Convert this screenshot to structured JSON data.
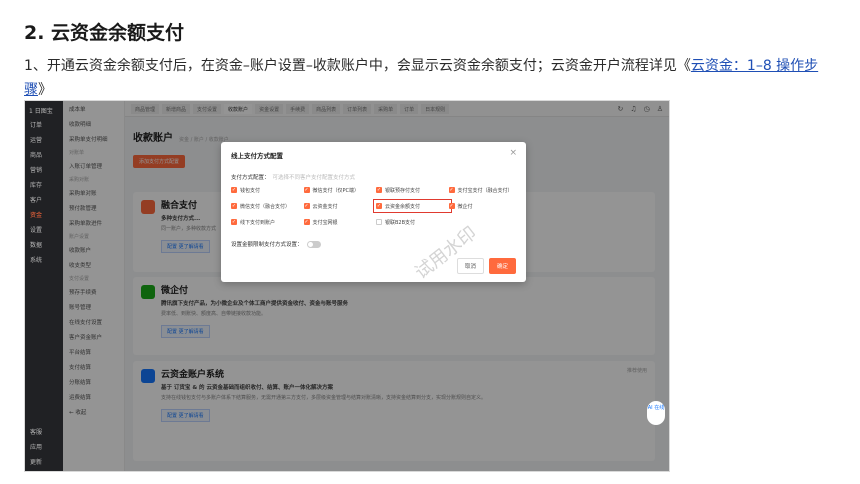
{
  "doc": {
    "title": "2. 云资金余额支付",
    "para_main": "1、开通云资金余额支付后，在资金–账户设置–收款账户中，会显示云资金余额支付；云资金开户流程详见《",
    "para_link": "云资金：1–8 操作步骤",
    "para_tail": "》"
  },
  "app": {
    "logo": "1 日图宝",
    "sidebar": [
      "订单",
      "运营",
      "商品",
      "营销",
      "库存",
      "客户",
      "资金",
      "设置",
      "数据",
      "系统"
    ],
    "sidebar_active_index": 6,
    "sidebar_footer": [
      "客服",
      "应用",
      "更新"
    ],
    "subnav": [
      {
        "type": "item",
        "label": "成本单"
      },
      {
        "type": "item",
        "label": "收款明细"
      },
      {
        "type": "item",
        "label": "采购单支付明细"
      },
      {
        "type": "group",
        "label": "对账单"
      },
      {
        "type": "item",
        "label": "入账订单管理"
      },
      {
        "type": "group",
        "label": "采购对账"
      },
      {
        "type": "item",
        "label": "采购单对账"
      },
      {
        "type": "item",
        "label": "预付款管理"
      },
      {
        "type": "item",
        "label": "采购单款进件"
      },
      {
        "type": "group",
        "label": "账户设置"
      },
      {
        "type": "item",
        "label": "收款账户"
      },
      {
        "type": "item",
        "label": "收支类型"
      },
      {
        "type": "group",
        "label": "支付设置"
      },
      {
        "type": "item",
        "label": "预存手续费"
      },
      {
        "type": "item",
        "label": "账号管理"
      },
      {
        "type": "item",
        "label": "在线支付设置"
      },
      {
        "type": "item",
        "label": "客户资金账户"
      },
      {
        "type": "item",
        "label": "平台结算"
      },
      {
        "type": "item",
        "label": "支付结算"
      },
      {
        "type": "item",
        "label": "分账结算"
      },
      {
        "type": "item",
        "label": "运费结算"
      },
      {
        "type": "item",
        "label": "← 收起"
      }
    ],
    "tabs": [
      "商品管理",
      "新增商品",
      "支付设置",
      "收款账户",
      "资金设置",
      "手续费",
      "商品列表",
      "订单列表",
      "采购单",
      "订单",
      "日本规则"
    ],
    "tabs_active_index": 3,
    "page_title": "收款账户",
    "breadcrumb": "资金 / 账户 / 收款账户",
    "add_button": "添加支付方式配置",
    "cards": [
      {
        "title": "融合支付",
        "desc": "多种支付方式...",
        "text": "同一账户，多种收款方式",
        "button": "配置 更了解请看"
      },
      {
        "title": "微企付",
        "logo_label": "微企付",
        "desc": "腾讯旗下支付产品，为小微企业及个体工商户提供资金收付、资金与账号服务",
        "text": "费率低、到账快、额度高、自带链接收款功能。",
        "button": "配置 更了解请看"
      },
      {
        "title": "云资金账户系统",
        "desc": "基于 订货宝 & 的 云资金基础而组织收付、结算、账户一体化解决方案",
        "text": "支持在线钱包支付与多账户体系下结算服务，无需开通第三方支付，多层级资金管理与结算对账清晰，支持资金结算到分支，实现分账规则自定义。",
        "button": "配置 更了解请看",
        "tag": "推荐使用"
      }
    ],
    "float_help": "AI 在线"
  },
  "modal": {
    "title": "线上支付方式配置",
    "close": "×",
    "label": "支付方式配置：",
    "hint": "可选择不同客户支付配置支付方式",
    "options": [
      {
        "label": "钱包支付",
        "checked": true
      },
      {
        "label": "微信支付（仅PC端）",
        "checked": true
      },
      {
        "label": "银联预存付支付",
        "checked": true
      },
      {
        "label": "支付宝支付（融合支付）",
        "checked": true
      },
      {
        "label": "微信支付（融合支付）",
        "checked": true
      },
      {
        "label": "云资金支付",
        "checked": true
      },
      {
        "label": "云资金余额支付",
        "checked": true,
        "highlight": true
      },
      {
        "label": "微企付",
        "checked": true
      },
      {
        "label": "线下支付到账户",
        "checked": true
      },
      {
        "label": "支付宝网银",
        "checked": true
      },
      {
        "label": "银联B2B支付",
        "checked": false
      }
    ],
    "switch_label": "设置金额限制支付方式设置：",
    "cancel": "取消",
    "confirm": "确定"
  },
  "watermark": "试用水印"
}
